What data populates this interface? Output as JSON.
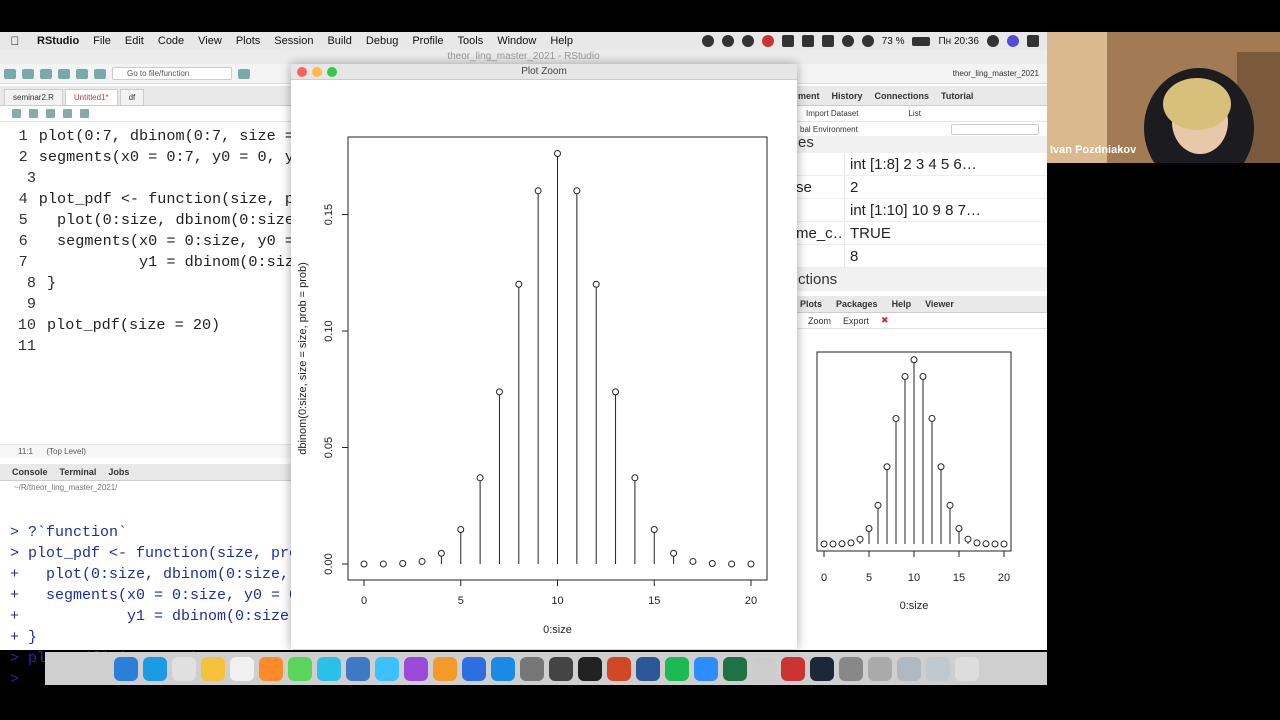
{
  "menubar": {
    "items": [
      "RStudio",
      "File",
      "Edit",
      "Code",
      "View",
      "Plots",
      "Session",
      "Build",
      "Debug",
      "Profile",
      "Tools",
      "Window",
      "Help"
    ],
    "battery": "73 %",
    "clock": "Пн 20:36"
  },
  "rstudio": {
    "title": "theor_ling_master_2021 - RStudio",
    "goto_placeholder": "Go to file/function",
    "project": "theor_ling_master_2021",
    "editor_tabs": [
      "seminar2.R",
      "Untitled1*",
      "df"
    ],
    "code": [
      {
        "n": "1",
        "text": "plot(0:7, dbinom(0:7, size ="
      },
      {
        "n": "2",
        "text": "segments(x0 = 0:7, y0 = 0, y"
      },
      {
        "n": "3",
        "text": ""
      },
      {
        "n": "4",
        "text": "plot_pdf <- function(size, p"
      },
      {
        "n": "5",
        "text": "  plot(0:size, dbinom(0:size"
      },
      {
        "n": "6",
        "text": "  segments(x0 = 0:size, y0 ="
      },
      {
        "n": "7",
        "text": "           y1 = dbinom(0:siz"
      },
      {
        "n": "8",
        "text": "}"
      },
      {
        "n": "9",
        "text": ""
      },
      {
        "n": "10",
        "text": "plot_pdf(size = 20)"
      },
      {
        "n": "11",
        "text": ""
      }
    ],
    "cursor_pos": "11:1",
    "scope": "(Top Level)",
    "console_tabs": [
      "Console",
      "Terminal",
      "Jobs"
    ],
    "console_path": "~/R/theor_ling_master_2021/",
    "console_lines": [
      "> ?`function`",
      "> plot_pdf <- function(size, pro",
      "+   plot(0:size, dbinom(0:size,",
      "+   segments(x0 = 0:size, y0 = 0",
      "+            y1 = dbinom(0:size,",
      "+ }",
      "> plot_pdf(size = 20)",
      "> "
    ],
    "env_tabs": [
      "ment",
      "History",
      "Connections",
      "Tutorial"
    ],
    "env_import": "Import Dataset",
    "env_list": "List",
    "env_scope": "bal Environment",
    "env_header": "es",
    "env_rows": [
      {
        "name": "",
        "value": "int [1:8] 2 3 4 5 6…"
      },
      {
        "name": "se",
        "value": "2"
      },
      {
        "name": "",
        "value": "int [1:10] 10 9 8 7…"
      },
      {
        "name": "me_c…",
        "value": "TRUE"
      },
      {
        "name": "",
        "value": "8"
      }
    ],
    "env_footer": "ctions",
    "plot_tabs": [
      "Plots",
      "Packages",
      "Help",
      "Viewer"
    ],
    "plot_zoom": "Zoom",
    "plot_export": "Export"
  },
  "zoom_window": {
    "title": "Plot Zoom"
  },
  "chart_data": [
    {
      "type": "scatter",
      "title": "",
      "xlabel": "0:size",
      "ylabel": "dbinom(0:size, size = size, prob = prob)",
      "xlim": [
        0,
        20
      ],
      "ylim": [
        0,
        0.176
      ],
      "xticks": [
        "0",
        "5",
        "10",
        "15",
        "20"
      ],
      "yticks": [
        "0.00",
        "0.05",
        "0.10",
        "0.15"
      ],
      "x": [
        0,
        1,
        2,
        3,
        4,
        5,
        6,
        7,
        8,
        9,
        10,
        11,
        12,
        13,
        14,
        15,
        16,
        17,
        18,
        19,
        20
      ],
      "y": [
        1e-06,
        2e-05,
        0.0002,
        0.0011,
        0.0046,
        0.0148,
        0.037,
        0.0739,
        0.1201,
        0.1602,
        0.1762,
        0.1602,
        0.1201,
        0.0739,
        0.037,
        0.0148,
        0.0046,
        0.0011,
        0.0002,
        2e-05,
        1e-06
      ],
      "segments": true
    },
    {
      "type": "scatter",
      "xlabel": "0:size",
      "xticks": [
        "0",
        "5",
        "10",
        "15",
        "20"
      ],
      "xlim": [
        0,
        20
      ],
      "ylim": [
        0,
        0.176
      ],
      "segments": true
    }
  ],
  "video": {
    "name": "Ivan Pozdniakov"
  }
}
